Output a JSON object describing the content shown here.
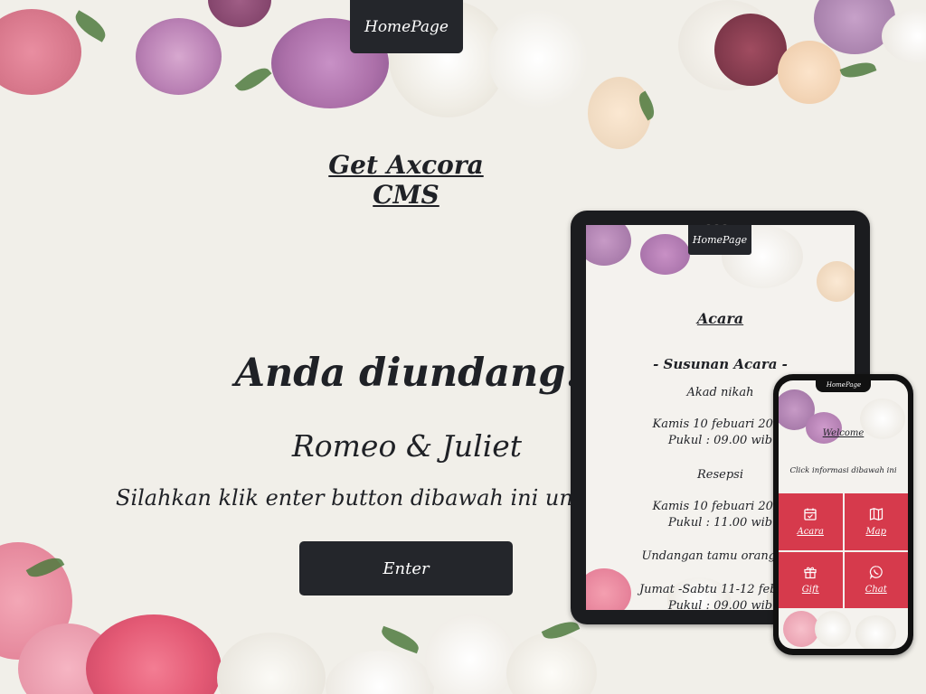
{
  "header": {
    "home_label": "HomePage"
  },
  "hero": {
    "cms_link": "Get Axcora CMS",
    "headline": "Anda diundang.",
    "couple": "Romeo & Juliet",
    "instruction": "Silahkan klik enter button dibawah ini untuk informasi lengkap",
    "enter_label": "Enter"
  },
  "tablet": {
    "home_label": "HomePage",
    "title": "Acara",
    "lines": [
      "- Susunan Acara -",
      "Akad nikah",
      "Kamis 10 febuari 2022",
      "Pukul : 09.00 wib",
      "Resepsi",
      "Kamis 10 febuari 2022",
      "Pukul : 11.00 wib",
      "Undangan tamu orang tua",
      "Jumat -Sabtu 11-12 febuari",
      "Pukul : 09.00 wib"
    ]
  },
  "phone": {
    "home_label": "HomePage",
    "welcome": "Welcome",
    "info": "Click informasi dibawah ini",
    "menu": [
      {
        "label": "Acara",
        "icon": "calendar-icon"
      },
      {
        "label": "Map",
        "icon": "map-icon"
      },
      {
        "label": "Gift",
        "icon": "gift-icon"
      },
      {
        "label": "Chat",
        "icon": "whatsapp-icon"
      }
    ]
  },
  "colors": {
    "dark": "#24262b",
    "accent": "#d63a4c",
    "background": "#f1efe9"
  }
}
